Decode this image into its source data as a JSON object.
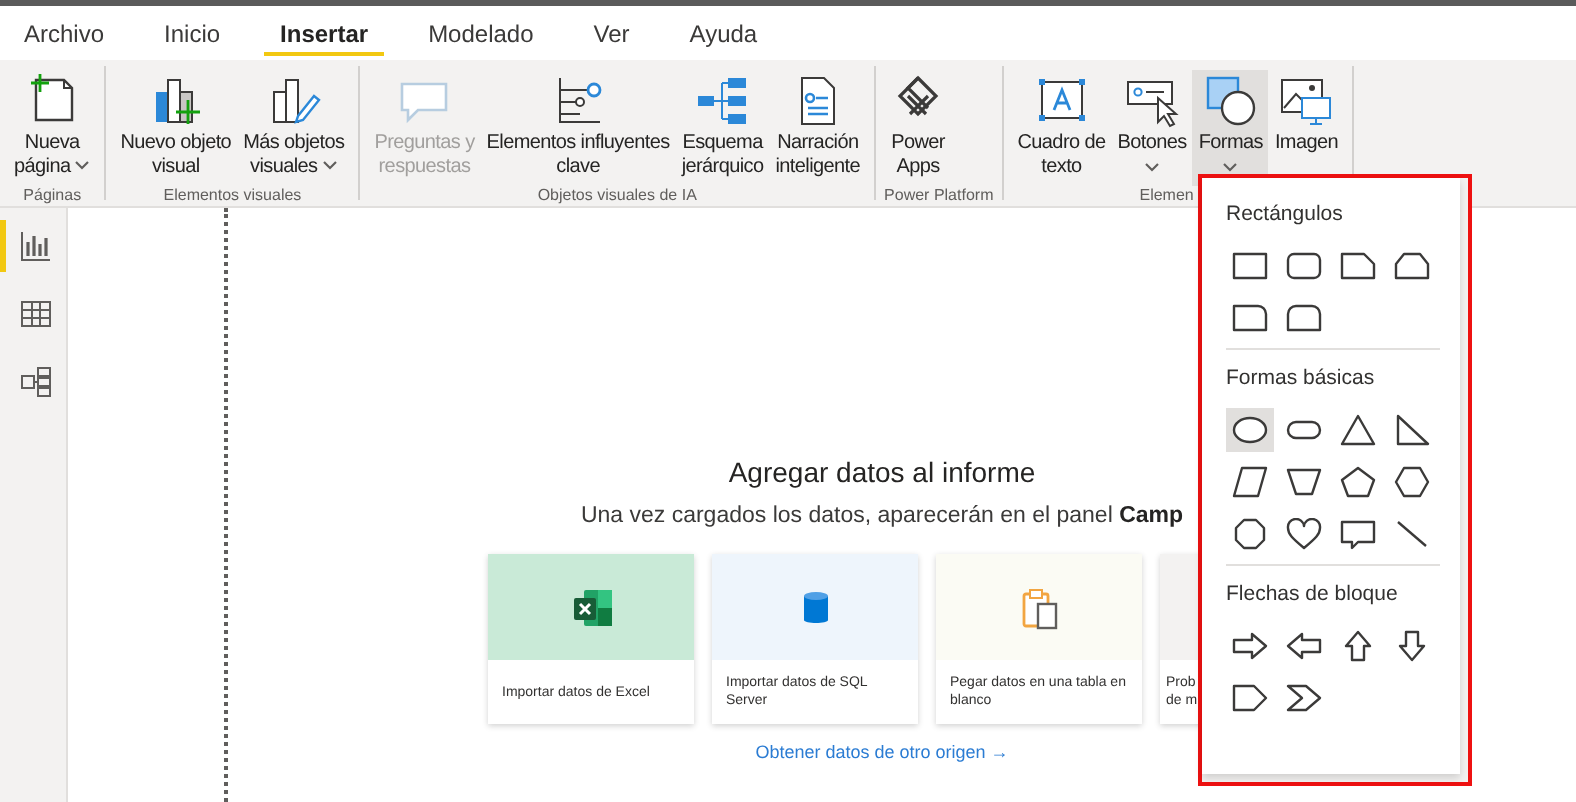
{
  "tabs": [
    {
      "label": "Archivo",
      "selected": false
    },
    {
      "label": "Inicio",
      "selected": false
    },
    {
      "label": "Insertar",
      "selected": true
    },
    {
      "label": "Modelado",
      "selected": false
    },
    {
      "label": "Ver",
      "selected": false
    },
    {
      "label": "Ayuda",
      "selected": false
    }
  ],
  "ribbon": {
    "groups": [
      {
        "label": "Páginas",
        "buttons": [
          {
            "kind": "new-page",
            "label": "Nueva\npágina",
            "dropdown": true,
            "disabled": false,
            "selected": false
          }
        ]
      },
      {
        "label": "Elementos visuales",
        "buttons": [
          {
            "kind": "new-visual",
            "label": "Nuevo objeto\nvisual",
            "dropdown": false,
            "disabled": false,
            "selected": false
          },
          {
            "kind": "more-visuals",
            "label": "Más objetos\nvisuales",
            "dropdown": true,
            "disabled": false,
            "selected": false
          }
        ]
      },
      {
        "label": "Objetos visuales de IA",
        "buttons": [
          {
            "kind": "qa",
            "label": "Preguntas y\nrespuestas",
            "dropdown": false,
            "disabled": true,
            "selected": false
          },
          {
            "kind": "influencers",
            "label": "Elementos influyentes\nclave",
            "dropdown": false,
            "disabled": false,
            "selected": false
          },
          {
            "kind": "decomposition",
            "label": "Esquema\njerárquico",
            "dropdown": false,
            "disabled": false,
            "selected": false
          },
          {
            "kind": "narrative",
            "label": "Narración\ninteligente",
            "dropdown": false,
            "disabled": false,
            "selected": false
          }
        ]
      },
      {
        "label": "Power Platform",
        "buttons": [
          {
            "kind": "power-apps",
            "label": "Power\nApps",
            "dropdown": false,
            "disabled": false,
            "selected": false
          }
        ]
      },
      {
        "label": "Elemen",
        "buttons": [
          {
            "kind": "text-box",
            "label": "Cuadro de\ntexto",
            "dropdown": false,
            "disabled": false,
            "selected": false
          },
          {
            "kind": "buttons",
            "label": "Botones",
            "dropdown": true,
            "disabled": false,
            "selected": false
          },
          {
            "kind": "shapes",
            "label": "Formas",
            "dropdown": true,
            "disabled": false,
            "selected": true
          },
          {
            "kind": "image",
            "label": "Imagen",
            "dropdown": false,
            "disabled": false,
            "selected": false
          }
        ]
      }
    ]
  },
  "sidebar": {
    "items": [
      {
        "kind": "report",
        "selected": true
      },
      {
        "kind": "data",
        "selected": false
      },
      {
        "kind": "model",
        "selected": false
      }
    ]
  },
  "canvas": {
    "title": "Agregar datos al informe",
    "subtitle": "Una vez cargados los datos, aparecerán en el panel **Camp**",
    "cards": [
      {
        "kind": "excel",
        "label": "Importar datos de Excel"
      },
      {
        "kind": "sql",
        "label": "Importar datos de SQL Server"
      },
      {
        "kind": "paste",
        "label": "Pegar datos en una tabla en blanco"
      },
      {
        "kind": "sample",
        "label": "Prob\nde m"
      }
    ],
    "link": "Obtener datos de otro origen →"
  },
  "shape_menu": {
    "sections": [
      {
        "title": "Rectángulos",
        "shapes": [
          {
            "kind": "rectangle",
            "selected": false
          },
          {
            "kind": "rounded-rectangle",
            "selected": false
          },
          {
            "kind": "snip-corner",
            "selected": false
          },
          {
            "kind": "snip-top",
            "selected": false
          },
          {
            "kind": "round-corner",
            "selected": false
          },
          {
            "kind": "round-top",
            "selected": false
          }
        ]
      },
      {
        "title": "Formas básicas",
        "shapes": [
          {
            "kind": "oval",
            "selected": true
          },
          {
            "kind": "pill",
            "selected": false
          },
          {
            "kind": "triangle",
            "selected": false
          },
          {
            "kind": "right-triangle",
            "selected": false
          },
          {
            "kind": "parallelogram",
            "selected": false
          },
          {
            "kind": "trapezoid",
            "selected": false
          },
          {
            "kind": "pentagon",
            "selected": false
          },
          {
            "kind": "hexagon",
            "selected": false
          },
          {
            "kind": "octagon",
            "selected": false
          },
          {
            "kind": "heart",
            "selected": false
          },
          {
            "kind": "callout",
            "selected": false
          },
          {
            "kind": "line",
            "selected": false
          }
        ]
      },
      {
        "title": "Flechas de bloque",
        "shapes": [
          {
            "kind": "arrow-right",
            "selected": false
          },
          {
            "kind": "arrow-left",
            "selected": false
          },
          {
            "kind": "arrow-up",
            "selected": false
          },
          {
            "kind": "arrow-down",
            "selected": false
          },
          {
            "kind": "pentagon-arrow",
            "selected": false
          },
          {
            "kind": "chevron",
            "selected": false
          }
        ]
      }
    ]
  }
}
